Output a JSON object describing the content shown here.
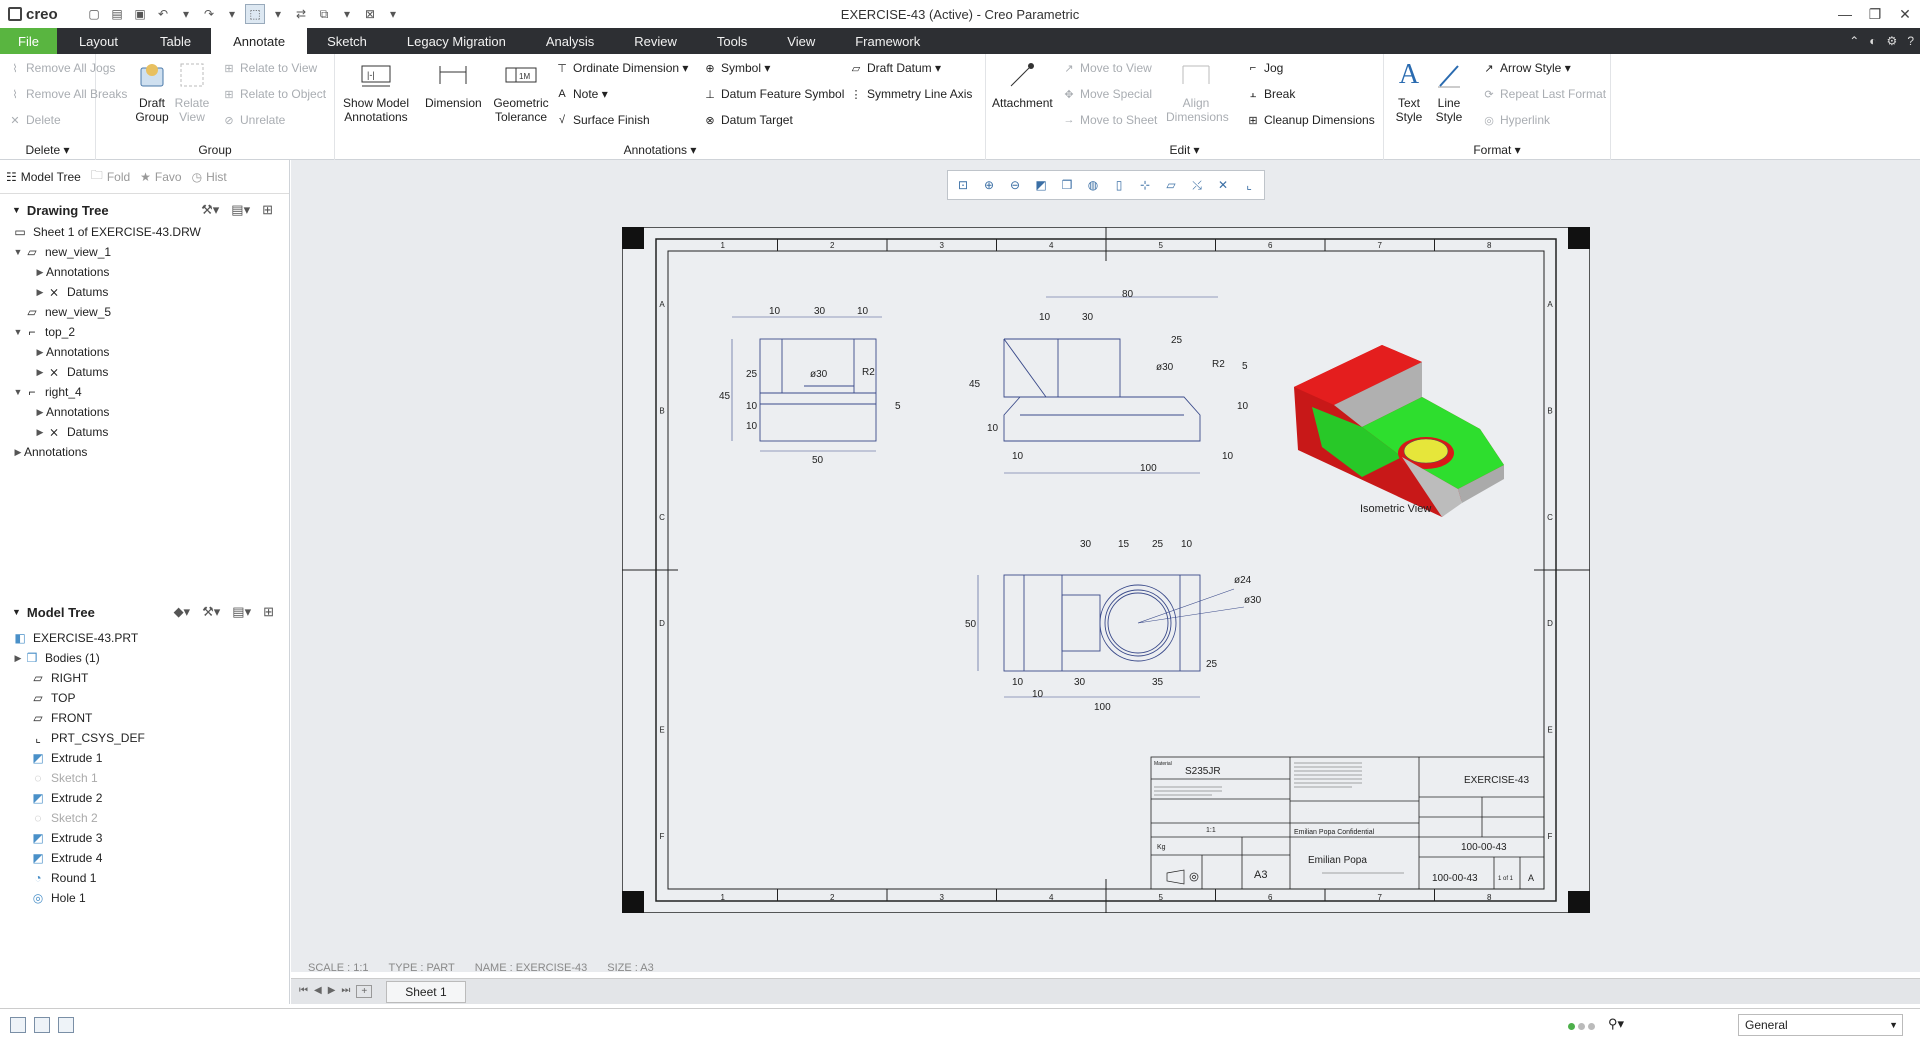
{
  "window": {
    "title": "EXERCISE-43 (Active) - Creo Parametric",
    "brand": "creo"
  },
  "menu": {
    "tabs": [
      "File",
      "Layout",
      "Table",
      "Annotate",
      "Sketch",
      "Legacy Migration",
      "Analysis",
      "Review",
      "Tools",
      "View",
      "Framework"
    ],
    "active": "Annotate"
  },
  "ribbon": {
    "delete": {
      "label": "Delete",
      "items": [
        "Remove All Jogs",
        "Remove All Breaks",
        "Delete"
      ]
    },
    "group": {
      "label": "Group",
      "draft_group": "Draft Group",
      "relate_view": "Relate View",
      "items": [
        "Relate to View",
        "Relate to Object",
        "Unrelate"
      ]
    },
    "annotations": {
      "label": "Annotations",
      "show_model": "Show Model Annotations",
      "dimension": "Dimension",
      "geometric": "Geometric Tolerance",
      "items": [
        "Ordinate Dimension",
        "Note",
        "Surface Finish",
        "Symbol",
        "Datum Feature Symbol",
        "Datum Target",
        "Draft Datum",
        "Symmetry Line Axis"
      ]
    },
    "edit": {
      "label": "Edit",
      "attachment": "Attachment",
      "align": "Align Dimensions",
      "items": [
        "Move to View",
        "Move Special",
        "Move to Sheet",
        "Jog",
        "Break",
        "Cleanup Dimensions"
      ]
    },
    "format": {
      "label": "Format",
      "text_style": "Text Style",
      "line_style": "Line Style",
      "items": [
        "Arrow Style",
        "Repeat Last Format",
        "Hyperlink"
      ]
    }
  },
  "panel": {
    "tabs": [
      "Model Tree",
      "Fold",
      "Favo",
      "Hist"
    ],
    "drawing_tree": {
      "title": "Drawing Tree",
      "nodes": [
        "Sheet 1 of EXERCISE-43.DRW",
        "new_view_1",
        "Annotations",
        "Datums",
        "new_view_5",
        "top_2",
        "Annotations",
        "Datums",
        "right_4",
        "Annotations",
        "Datums",
        "Annotations"
      ]
    },
    "model_tree": {
      "title": "Model Tree",
      "nodes": [
        "EXERCISE-43.PRT",
        "Bodies (1)",
        "RIGHT",
        "TOP",
        "FRONT",
        "PRT_CSYS_DEF",
        "Extrude 1",
        "Sketch 1",
        "Extrude 2",
        "Sketch 2",
        "Extrude 3",
        "Extrude 4",
        "Round 1",
        "Hole 1"
      ]
    }
  },
  "status": {
    "scale": "SCALE : 1:1",
    "type": "TYPE : PART",
    "name": "NAME : EXERCISE-43",
    "size": "SIZE : A3"
  },
  "sheet": {
    "tab": "Sheet 1"
  },
  "filter": "General",
  "drawing": {
    "iso_label": "Isometric View",
    "zones_h": [
      "1",
      "2",
      "3",
      "4",
      "5",
      "6",
      "7",
      "8"
    ],
    "zones_v": [
      "A",
      "B",
      "C",
      "D",
      "E",
      "F"
    ],
    "title_block": {
      "material_label": "Material",
      "material": "S235JR",
      "title": "EXERCISE-43",
      "confidential": "Emilian Popa Confidential",
      "owner": "Emilian Popa",
      "part_number": "100-00-43",
      "drawing_number": "100-00-43",
      "size": "A3",
      "revision": "A",
      "sheet": "1 of 1",
      "scale": "1:1",
      "weight": "Kg"
    },
    "dims": {
      "front": [
        "10",
        "30",
        "10",
        "ø30",
        "R2",
        "25",
        "45",
        "10",
        "10",
        "5",
        "50"
      ],
      "top": [
        "80",
        "10",
        "30",
        "25",
        "ø30",
        "R2",
        "5",
        "45",
        "10",
        "10",
        "10",
        "10",
        "100"
      ],
      "bottom": [
        "30",
        "15",
        "25",
        "10",
        "ø24",
        "ø30",
        "50",
        "25",
        "10",
        "30",
        "35",
        "10",
        "100"
      ]
    }
  }
}
